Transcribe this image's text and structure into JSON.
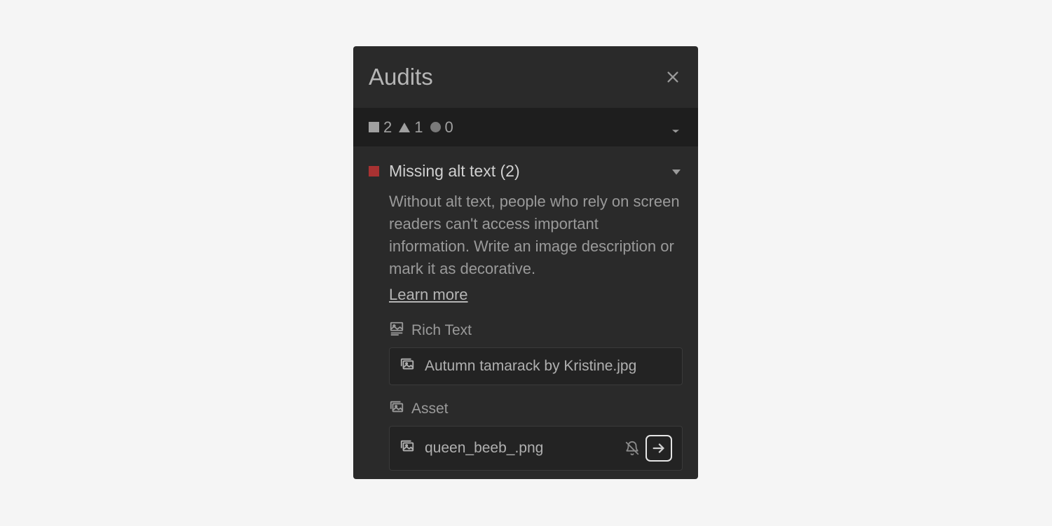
{
  "panel": {
    "title": "Audits",
    "summary": {
      "errors": "2",
      "warnings": "1",
      "info": "0"
    },
    "issue": {
      "title": "Missing alt text (2)",
      "description": "Without alt text, people who rely on screen readers can't access important information. Write an image description or mark it as decorative.",
      "learnMore": "Learn more",
      "groups": [
        {
          "label": "Rich Text",
          "assets": [
            {
              "filename": "Autumn tamarack by Kristine.jpg",
              "showActions": false
            }
          ]
        },
        {
          "label": "Asset",
          "assets": [
            {
              "filename": "queen_beeb_.png",
              "showActions": true
            }
          ]
        }
      ]
    }
  }
}
